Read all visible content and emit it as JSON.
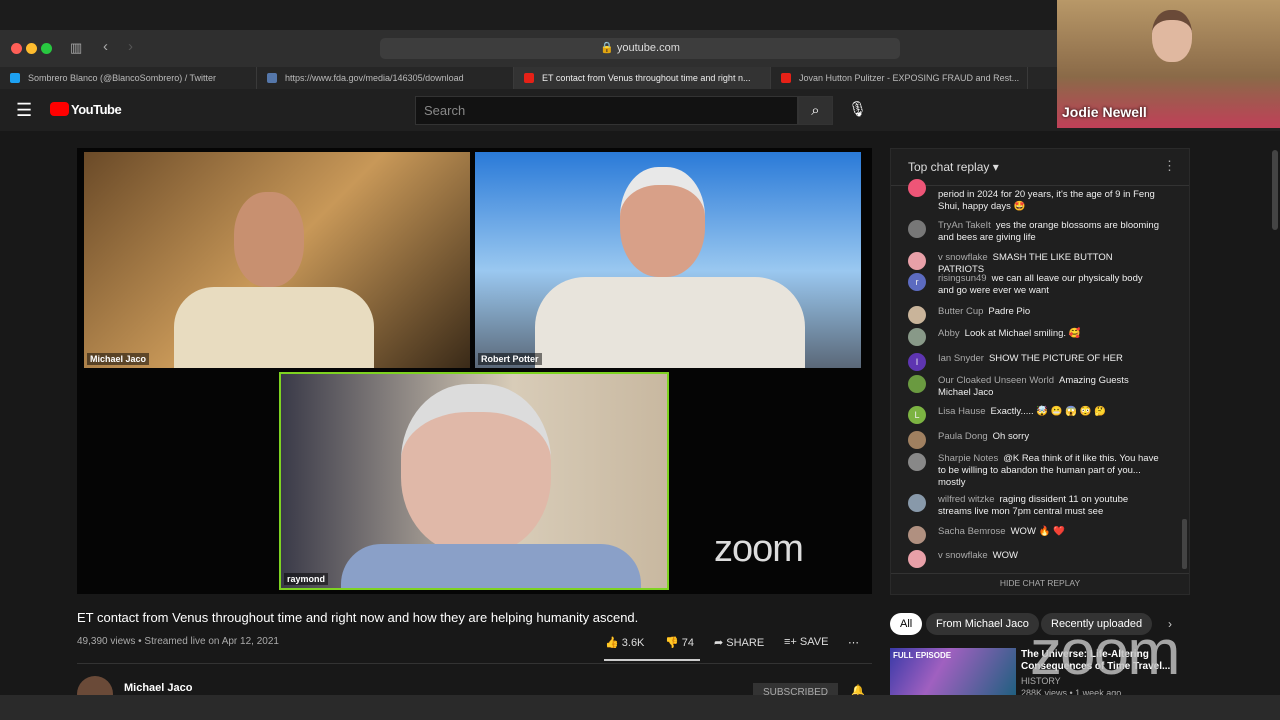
{
  "browser": {
    "url": "youtube.com",
    "tabs": [
      {
        "label": "Sombrero Blanco (@BlancoSombrero) / Twitter",
        "color": "#1da1f2"
      },
      {
        "label": "https://www.fda.gov/media/146305/download",
        "color": "#5577aa"
      },
      {
        "label": "ET contact from Venus throughout time and right n...",
        "color": "#e62117",
        "active": true
      },
      {
        "label": "Jovan Hutton Pulitzer - EXPOSING FRAUD and Rest...",
        "color": "#e62117"
      }
    ]
  },
  "youtube": {
    "logo": "YouTube",
    "search_placeholder": "Search"
  },
  "webcam": {
    "name": "Jodie Newell"
  },
  "video": {
    "participants": [
      "Michael Jaco",
      "Robert Potter",
      "raymond"
    ],
    "watermark": "zoom",
    "active_speaker_color": "#7ed321"
  },
  "info": {
    "title": "ET contact from Venus throughout time and right now and how they are helping humanity ascend.",
    "meta": "49,390 views • Streamed live on Apr 12, 2021",
    "likes": "3.6K",
    "dislikes": "74",
    "share": "SHARE",
    "save": "SAVE",
    "channel": "Michael Jaco",
    "subscribe": "SUBSCRIBED"
  },
  "chat": {
    "header": "Top chat replay",
    "hide": "HIDE CHAT REPLAY",
    "messages": [
      {
        "author": "",
        "text": "period in 2024 for 20 years, it's the age of 9 in Feng Shui, happy days 🤩",
        "color": "#e57"
      },
      {
        "author": "TryAn TakeIt",
        "text": "yes the orange blossoms are blooming and bees are giving life",
        "color": "#777"
      },
      {
        "author": "v snowflake",
        "text": "SMASH THE LIKE BUTTON PATRIOTS",
        "color": "#e8a0a8"
      },
      {
        "author": "risingsun49",
        "text": "we can all leave our physically body and go were ever we want",
        "color": "#5c6bc0",
        "initial": "r"
      },
      {
        "author": "Butter Cup",
        "text": "Padre Pio",
        "color": "#c9b49a"
      },
      {
        "author": "Abby",
        "text": "Look at Michael smiling. 🥰",
        "color": "#889988"
      },
      {
        "author": "Ian Snyder",
        "text": "SHOW THE PICTURE OF HER",
        "color": "#5e35b1",
        "initial": "I"
      },
      {
        "author": "Our Cloaked Unseen World",
        "text": "Amazing Guests Michael Jaco",
        "color": "#6a9a40"
      },
      {
        "author": "Lisa Hause",
        "text": "Exactly..... 🤯 😬 😱 😳 🤔",
        "color": "#7cb342",
        "initial": "L"
      },
      {
        "author": "Paula Dong",
        "text": "Oh sorry",
        "color": "#a08060"
      },
      {
        "author": "Sharpie Notes",
        "text": "@K Rea think of it like this. You have to be willing to abandon the human part of you... mostly",
        "color": "#888"
      },
      {
        "author": "wilfred witzke",
        "text": "raging dissident 11 on youtube streams live mon 7pm central must see",
        "color": "#8899aa"
      },
      {
        "author": "Sacha Bemrose",
        "text": "WOW 🔥 ❤️",
        "color": "#b09080"
      },
      {
        "author": "v snowflake",
        "text": "WOW",
        "color": "#e8a0a8"
      }
    ]
  },
  "chips": [
    "All",
    "From Michael Jaco",
    "Recently uploaded"
  ],
  "recommended": {
    "badge": "FULL EPISODE",
    "title": "The Universe: Life-Altering Consequences of Time Travel...",
    "channel": "HISTORY",
    "meta": "288K views • 1 week ago"
  }
}
